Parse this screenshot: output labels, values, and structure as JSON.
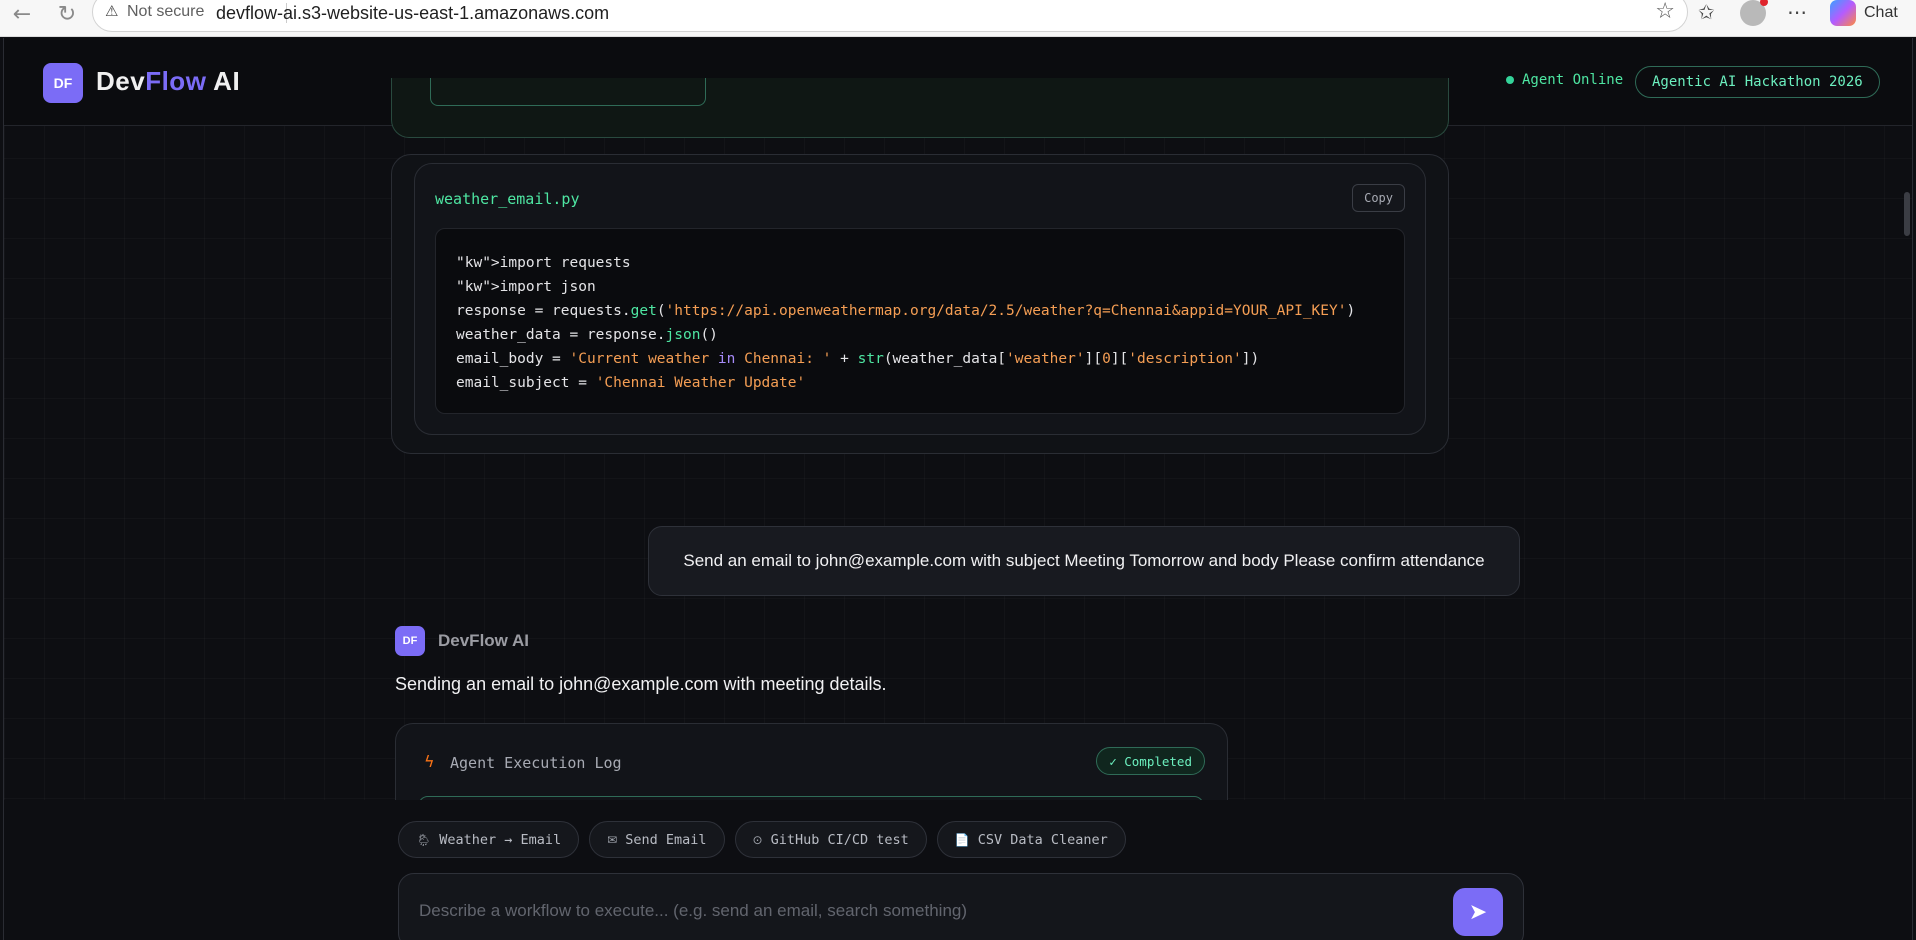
{
  "browser": {
    "security_label": "Not secure",
    "url": "devflow-ai.s3-website-us-east-1.amazonaws.com",
    "chat_label": "Chat"
  },
  "header": {
    "logo_badge": "DF",
    "logo_main": "Dev",
    "logo_accent": "Flow",
    "logo_suffix": " AI",
    "status": "Agent Online",
    "event_badge": "Agentic AI Hackathon 2026"
  },
  "code_block": {
    "filename": "weather_email.py",
    "copy_label": "Copy",
    "lines": [
      "\"kw\">import requests",
      "\"kw\">import json",
      "response = requests.get('https://api.openweathermap.org/data/2.5/weather?q=Chennai&appid=YOUR_API_KEY')",
      "weather_data = response.json()",
      "email_body = 'Current weather in Chennai: ' + str(weather_data['weather'][0]['description'])",
      "email_subject = 'Chennai Weather Update'"
    ]
  },
  "messages": {
    "user": "Send an email to john@example.com with subject Meeting Tomorrow and body Please confirm attendance",
    "ai_badge": "DF",
    "ai_name": "DevFlow AI",
    "ai_text": "Sending an email to john@example.com with meeting details."
  },
  "execution_log": {
    "title": "Agent Execution Log",
    "status": "✓ Completed"
  },
  "suggestions": [
    {
      "icon": "🌦",
      "label": "Weather → Email"
    },
    {
      "icon": "✉",
      "label": "Send Email"
    },
    {
      "icon": "⊙",
      "label": "GitHub CI/CD test"
    },
    {
      "icon": "📄",
      "label": "CSV Data Cleaner"
    }
  ],
  "composer": {
    "placeholder": "Describe a workflow to execute... (e.g. send an email, search something)"
  },
  "colors": {
    "accent": "#7b6cf6",
    "success": "#4ee6a2",
    "string": "#f59e54"
  }
}
